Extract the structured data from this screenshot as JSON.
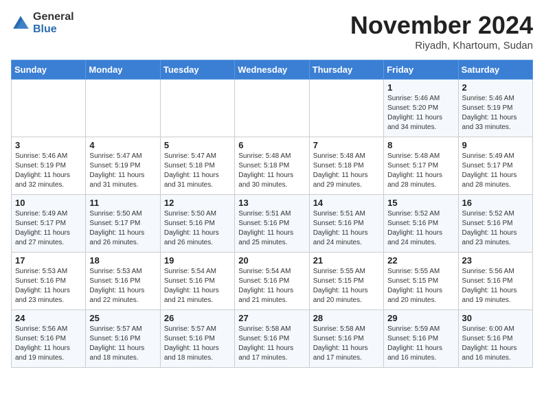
{
  "logo": {
    "general": "General",
    "blue": "Blue"
  },
  "header": {
    "month": "November 2024",
    "location": "Riyadh, Khartoum, Sudan"
  },
  "weekdays": [
    "Sunday",
    "Monday",
    "Tuesday",
    "Wednesday",
    "Thursday",
    "Friday",
    "Saturday"
  ],
  "weeks": [
    [
      {
        "day": "",
        "info": ""
      },
      {
        "day": "",
        "info": ""
      },
      {
        "day": "",
        "info": ""
      },
      {
        "day": "",
        "info": ""
      },
      {
        "day": "",
        "info": ""
      },
      {
        "day": "1",
        "info": "Sunrise: 5:46 AM\nSunset: 5:20 PM\nDaylight: 11 hours\nand 34 minutes."
      },
      {
        "day": "2",
        "info": "Sunrise: 5:46 AM\nSunset: 5:19 PM\nDaylight: 11 hours\nand 33 minutes."
      }
    ],
    [
      {
        "day": "3",
        "info": "Sunrise: 5:46 AM\nSunset: 5:19 PM\nDaylight: 11 hours\nand 32 minutes."
      },
      {
        "day": "4",
        "info": "Sunrise: 5:47 AM\nSunset: 5:19 PM\nDaylight: 11 hours\nand 31 minutes."
      },
      {
        "day": "5",
        "info": "Sunrise: 5:47 AM\nSunset: 5:18 PM\nDaylight: 11 hours\nand 31 minutes."
      },
      {
        "day": "6",
        "info": "Sunrise: 5:48 AM\nSunset: 5:18 PM\nDaylight: 11 hours\nand 30 minutes."
      },
      {
        "day": "7",
        "info": "Sunrise: 5:48 AM\nSunset: 5:18 PM\nDaylight: 11 hours\nand 29 minutes."
      },
      {
        "day": "8",
        "info": "Sunrise: 5:48 AM\nSunset: 5:17 PM\nDaylight: 11 hours\nand 28 minutes."
      },
      {
        "day": "9",
        "info": "Sunrise: 5:49 AM\nSunset: 5:17 PM\nDaylight: 11 hours\nand 28 minutes."
      }
    ],
    [
      {
        "day": "10",
        "info": "Sunrise: 5:49 AM\nSunset: 5:17 PM\nDaylight: 11 hours\nand 27 minutes."
      },
      {
        "day": "11",
        "info": "Sunrise: 5:50 AM\nSunset: 5:17 PM\nDaylight: 11 hours\nand 26 minutes."
      },
      {
        "day": "12",
        "info": "Sunrise: 5:50 AM\nSunset: 5:16 PM\nDaylight: 11 hours\nand 26 minutes."
      },
      {
        "day": "13",
        "info": "Sunrise: 5:51 AM\nSunset: 5:16 PM\nDaylight: 11 hours\nand 25 minutes."
      },
      {
        "day": "14",
        "info": "Sunrise: 5:51 AM\nSunset: 5:16 PM\nDaylight: 11 hours\nand 24 minutes."
      },
      {
        "day": "15",
        "info": "Sunrise: 5:52 AM\nSunset: 5:16 PM\nDaylight: 11 hours\nand 24 minutes."
      },
      {
        "day": "16",
        "info": "Sunrise: 5:52 AM\nSunset: 5:16 PM\nDaylight: 11 hours\nand 23 minutes."
      }
    ],
    [
      {
        "day": "17",
        "info": "Sunrise: 5:53 AM\nSunset: 5:16 PM\nDaylight: 11 hours\nand 23 minutes."
      },
      {
        "day": "18",
        "info": "Sunrise: 5:53 AM\nSunset: 5:16 PM\nDaylight: 11 hours\nand 22 minutes."
      },
      {
        "day": "19",
        "info": "Sunrise: 5:54 AM\nSunset: 5:16 PM\nDaylight: 11 hours\nand 21 minutes."
      },
      {
        "day": "20",
        "info": "Sunrise: 5:54 AM\nSunset: 5:16 PM\nDaylight: 11 hours\nand 21 minutes."
      },
      {
        "day": "21",
        "info": "Sunrise: 5:55 AM\nSunset: 5:15 PM\nDaylight: 11 hours\nand 20 minutes."
      },
      {
        "day": "22",
        "info": "Sunrise: 5:55 AM\nSunset: 5:15 PM\nDaylight: 11 hours\nand 20 minutes."
      },
      {
        "day": "23",
        "info": "Sunrise: 5:56 AM\nSunset: 5:16 PM\nDaylight: 11 hours\nand 19 minutes."
      }
    ],
    [
      {
        "day": "24",
        "info": "Sunrise: 5:56 AM\nSunset: 5:16 PM\nDaylight: 11 hours\nand 19 minutes."
      },
      {
        "day": "25",
        "info": "Sunrise: 5:57 AM\nSunset: 5:16 PM\nDaylight: 11 hours\nand 18 minutes."
      },
      {
        "day": "26",
        "info": "Sunrise: 5:57 AM\nSunset: 5:16 PM\nDaylight: 11 hours\nand 18 minutes."
      },
      {
        "day": "27",
        "info": "Sunrise: 5:58 AM\nSunset: 5:16 PM\nDaylight: 11 hours\nand 17 minutes."
      },
      {
        "day": "28",
        "info": "Sunrise: 5:58 AM\nSunset: 5:16 PM\nDaylight: 11 hours\nand 17 minutes."
      },
      {
        "day": "29",
        "info": "Sunrise: 5:59 AM\nSunset: 5:16 PM\nDaylight: 11 hours\nand 16 minutes."
      },
      {
        "day": "30",
        "info": "Sunrise: 6:00 AM\nSunset: 5:16 PM\nDaylight: 11 hours\nand 16 minutes."
      }
    ]
  ]
}
